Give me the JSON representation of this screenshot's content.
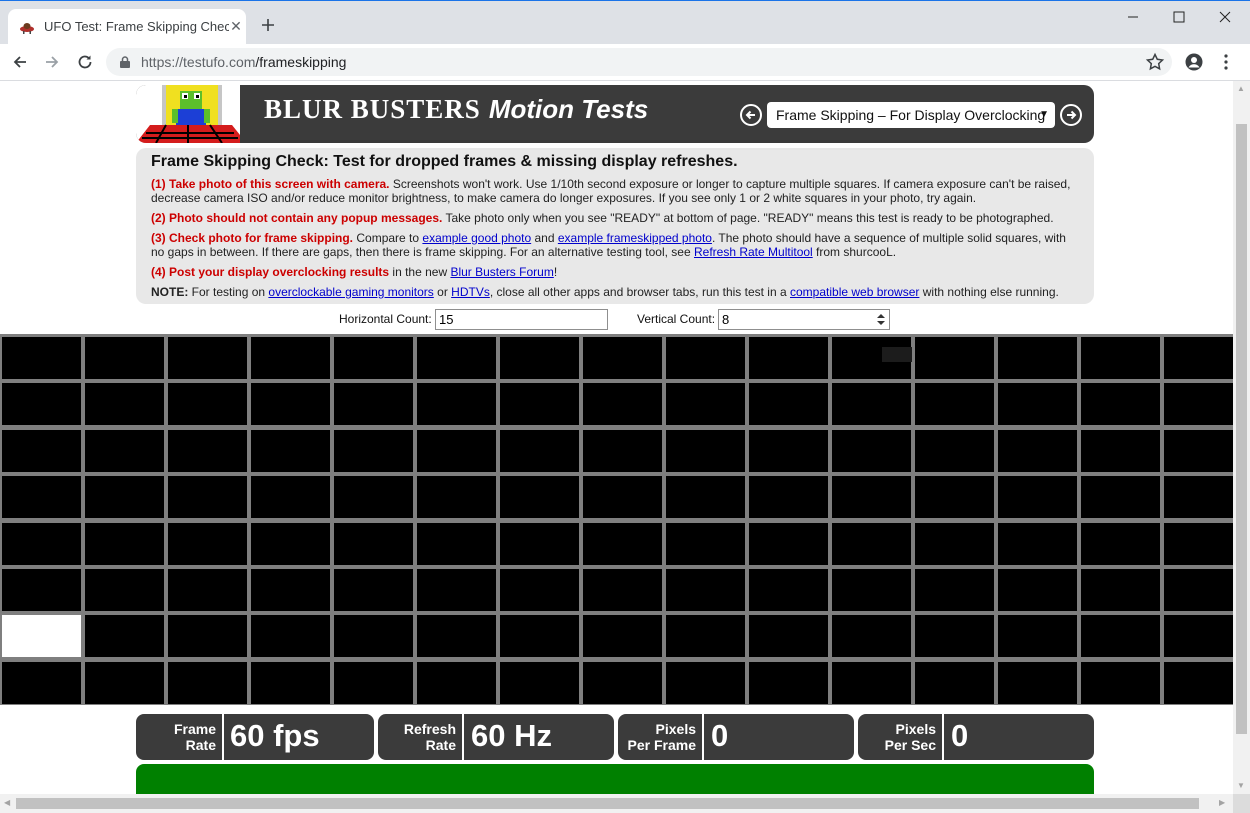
{
  "browser": {
    "tab_title": "UFO Test: Frame Skipping Check",
    "url_host": "https://testufo.com",
    "url_path": "/frameskipping"
  },
  "header": {
    "brand": "BLUR BUSTERS",
    "brand_suffix": "Motion Tests",
    "selected_test": "Frame Skipping – For Display Overclocking"
  },
  "info": {
    "title": "Frame Skipping Check: Test for dropped frames & missing display refreshes.",
    "step1_head": "(1) Take photo of this screen with camera.",
    "step1_text": " Screenshots won't work. Use 1/10th second exposure or longer to capture multiple squares. If camera exposure can't be raised, decrease camera ISO and/or reduce monitor brightness, to make camera do longer exposures. If you see only 1 or 2 white squares in your photo, try again.",
    "step2_head": "(2) Photo should not contain any popup messages.",
    "step2_text": " Take photo only when you see \"READY\" at bottom of page. \"READY\" means this test is ready to be photographed.",
    "step3_head": "(3) Check photo for frame skipping.",
    "step3_a": " Compare to ",
    "step3_link1": "example good photo",
    "step3_b": " and ",
    "step3_link2": "example frameskipped photo",
    "step3_c": ". The photo should have a sequence of multiple solid squares, with no gaps in between. If there are gaps, then there is frame skipping. For an alternative testing tool, see ",
    "step3_link3": "Refresh Rate Multitool",
    "step3_d": " from shurcooL.",
    "step4_head": "(4) Post your display overclocking results",
    "step4_a": " in the new ",
    "step4_link": "Blur Busters Forum",
    "step4_b": "!",
    "note_head": "NOTE:",
    "note_a": " For testing on ",
    "note_link1": "overclockable gaming monitors",
    "note_b": " or ",
    "note_link2": "HDTVs",
    "note_c": ", close all other apps and browser tabs, run this test in a ",
    "note_link3": "compatible web browser",
    "note_d": " with nothing else running."
  },
  "controls": {
    "horizontal_label": "Horizontal Count:",
    "horizontal_value": "15",
    "vertical_label": "Vertical Count:",
    "vertical_value": "8"
  },
  "grid": {
    "columns": 15,
    "rows": 8,
    "lit_cell": {
      "row": 7,
      "col": 1
    }
  },
  "stats": {
    "frame_rate_l1": "Frame",
    "frame_rate_l2": "Rate",
    "frame_rate_value": "60 fps",
    "refresh_rate_l1": "Refresh",
    "refresh_rate_l2": "Rate",
    "refresh_rate_value": "60 Hz",
    "ppf_l1": "Pixels",
    "ppf_l2": "Per Frame",
    "ppf_value": "0",
    "pps_l1": "Pixels",
    "pps_l2": "Per Sec",
    "pps_value": "0"
  },
  "colors": {
    "panel": "#3b3b3b",
    "info_bg": "#e8e8e8",
    "step_red": "#cc0000",
    "status_green": "#008000",
    "grid_line": "#7f7f7f"
  }
}
